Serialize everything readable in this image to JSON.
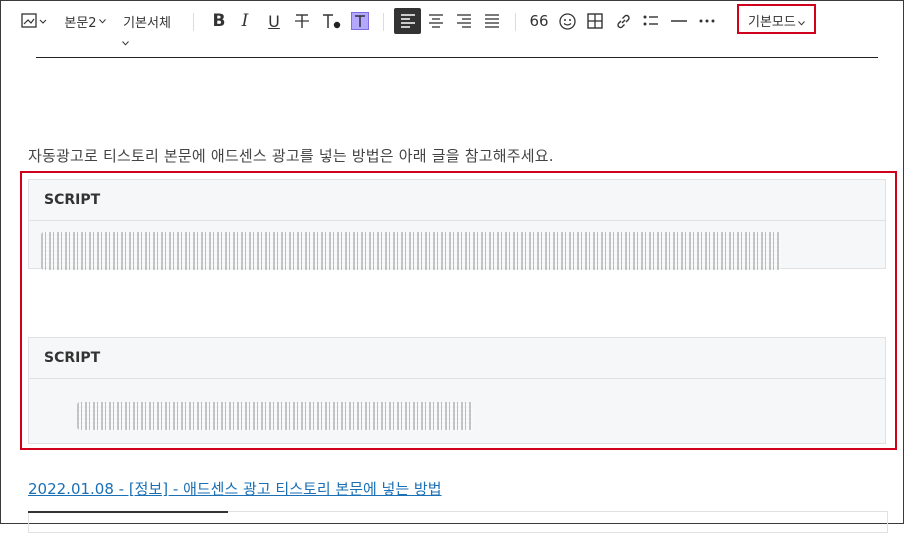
{
  "toolbar": {
    "paragraph_style": "본문2",
    "font_family": "기본서체",
    "mode": "기본모드"
  },
  "icons": {
    "image": "image-icon",
    "bold": "bold-icon",
    "italic": "italic-icon",
    "underline": "underline-icon",
    "strike": "strikethrough-icon",
    "text_color": "text-color-icon",
    "bg_color": "background-color-icon",
    "align_left": "align-left-icon",
    "align_center": "align-center-icon",
    "align_right": "align-right-icon",
    "justify": "align-justify-icon",
    "quote": "quote-icon",
    "emoji": "emoji-icon",
    "table": "table-icon",
    "link": "link-icon",
    "list": "bullet-list-icon",
    "divider": "horizontal-rule-icon",
    "more": "more-icon"
  },
  "content": {
    "intro": "자동광고로 티스토리 본문에 애드센스 광고를 넣는 방법은 아래 글을 참고해주세요.",
    "code_blocks": [
      {
        "header": "SCRIPT"
      },
      {
        "header": "SCRIPT"
      }
    ],
    "link_text": "2022.01.08 - [정보] - 애드센스 광고 티스토리 본문에 넣는 방법"
  },
  "colors": {
    "highlight_red": "#d0021b",
    "link": "#1a6fb5",
    "bg_color_swatch": "#b3a8ff"
  }
}
